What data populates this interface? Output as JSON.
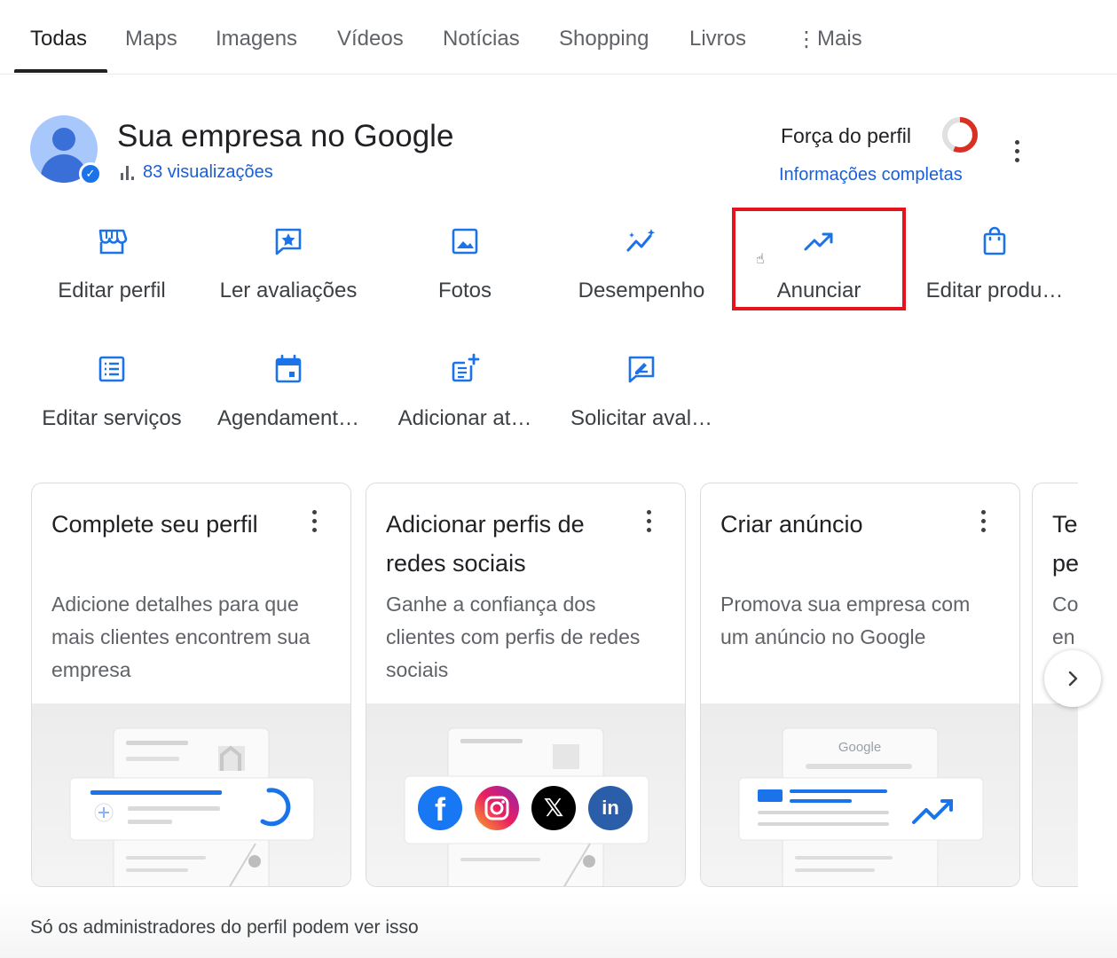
{
  "tabs": {
    "all": "Todas",
    "maps": "Maps",
    "images": "Imagens",
    "videos": "Vídeos",
    "news": "Notícias",
    "shopping": "Shopping",
    "books": "Livros",
    "more": "Mais"
  },
  "header": {
    "title": "Sua empresa no Google",
    "views": "83 visualizações",
    "strength_label": "Força do perfil",
    "strength_link": "Informações completas"
  },
  "actions": {
    "edit_profile": "Editar perfil",
    "read_reviews": "Ler avaliações",
    "photos": "Fotos",
    "performance": "Desempenho",
    "advertise": "Anunciar",
    "edit_products": "Editar produ…",
    "edit_services": "Editar serviços",
    "bookings": "Agendament…",
    "add_update": "Adicionar at…",
    "request_reviews": "Solicitar aval…"
  },
  "cards": [
    {
      "title": "Complete seu perfil",
      "desc": "Adicione detalhes para que mais clientes encontrem sua empresa"
    },
    {
      "title": "Adicionar perfis de redes sociais",
      "desc": "Ganhe a confiança dos clientes com perfis de redes sociais"
    },
    {
      "title": "Criar anúncio",
      "desc": "Promova sua empresa com um anúncio no Google"
    }
  ],
  "partial_card": {
    "title_line1": "Te",
    "title_line2": "pe",
    "desc_line1": "Co",
    "desc_line2": "en"
  },
  "illustration": {
    "google_word": "Google"
  },
  "footer": {
    "note": "Só os administradores do perfil podem ver isso"
  },
  "colors": {
    "accent_blue": "#1a73e8",
    "link_blue": "#1a5fd6",
    "highlight_red": "#e3141b",
    "strength_red": "#d93025"
  }
}
